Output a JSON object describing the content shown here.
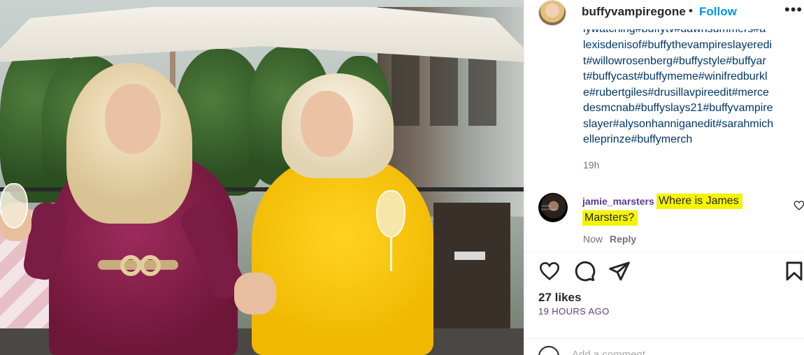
{
  "post": {
    "username": "buffyvampiregone",
    "separator": "•",
    "follow_label": "Follow",
    "more_label": "•••",
    "caption_clipped_line": "lywatching#buffytv#dawnsummers#a",
    "caption_lines": [
      "lexisdenisof#buffythevampireslayeredi",
      "t#willowrosenberg#buffystyle#buffyar",
      "t#buffycast#buffymeme#winifredburkl",
      "e#rubertgiles#drusillavpireedit#merce",
      "desmcnab#buffyslays21#buffyvampire",
      "slayer#alysonhanniganedit#sarahmich",
      "elleprinze#buffymerch"
    ],
    "caption_time": "19h"
  },
  "comment": {
    "username": "jamie_marsters",
    "text_line1": "Where is James",
    "text_line2": "Marsters?",
    "time": "Now",
    "reply_label": "Reply",
    "avatar_text": "JAMES MARSTERS"
  },
  "footer": {
    "likes": "27 likes",
    "date": "19 HOURS AGO",
    "add_comment_placeholder": "Add a comment..."
  },
  "icons": {
    "like": "heart-icon",
    "comment": "comment-icon",
    "share": "share-icon",
    "save": "bookmark-icon",
    "comment_like": "heart-icon",
    "emoji": "emoji-icon",
    "more": "more-icon"
  },
  "colors": {
    "follow": "#0095f6",
    "hashtag": "#00376b",
    "highlight": "#f4f400",
    "comment_user": "#5b3a91",
    "muted": "#737373"
  }
}
